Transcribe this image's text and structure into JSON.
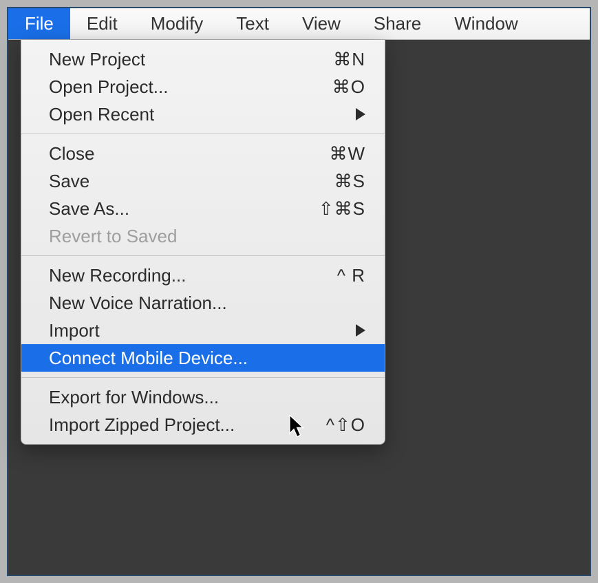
{
  "menubar": {
    "items": [
      {
        "label": "File",
        "active": true
      },
      {
        "label": "Edit"
      },
      {
        "label": "Modify"
      },
      {
        "label": "Text"
      },
      {
        "label": "View"
      },
      {
        "label": "Share"
      },
      {
        "label": "Window"
      }
    ]
  },
  "dropdown": {
    "groups": [
      [
        {
          "label": "New Project",
          "shortcut": "⌘N"
        },
        {
          "label": "Open Project...",
          "shortcut": "⌘O"
        },
        {
          "label": "Open Recent",
          "submenu": true
        }
      ],
      [
        {
          "label": "Close",
          "shortcut": "⌘W"
        },
        {
          "label": "Save",
          "shortcut": "⌘S"
        },
        {
          "label": "Save As...",
          "shortcut": "⇧⌘S"
        },
        {
          "label": "Revert to Saved",
          "disabled": true
        }
      ],
      [
        {
          "label": "New Recording...",
          "shortcut": "^ R"
        },
        {
          "label": "New Voice Narration..."
        },
        {
          "label": "Import",
          "submenu": true
        },
        {
          "label": "Connect Mobile Device...",
          "highlighted": true
        }
      ],
      [
        {
          "label": "Export for Windows..."
        },
        {
          "label": "Import Zipped Project...",
          "shortcut": "^⇧O"
        }
      ]
    ]
  }
}
